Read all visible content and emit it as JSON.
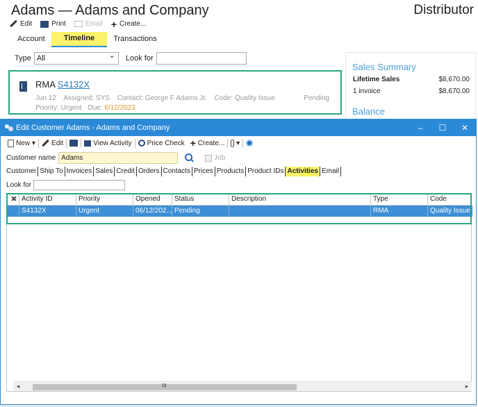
{
  "background": {
    "title": "Adams — Adams and Company",
    "role": "Distributor",
    "toolbar": {
      "edit": "Edit",
      "print": "Print",
      "email": "Email",
      "create": "Create..."
    },
    "tabs": [
      "Account",
      "Timeline",
      "Transactions"
    ],
    "filter": {
      "type_label": "Type",
      "type_value": "All",
      "look_label": "Look for",
      "look_value": ""
    },
    "activity_card": {
      "kind": "RMA",
      "number": "S4132X",
      "date": "Jun 12",
      "assigned": "Assigned: SYS",
      "contact": "Contact: George F Adams Jr.",
      "code": "Code: Quality Issue",
      "status": "Pending",
      "priority": "Priority: Urgent",
      "due_label": "Due:",
      "due_value": "6/12/2023"
    },
    "sales_summary": {
      "title": "Sales Summary",
      "lifetime_label": "Lifetime Sales",
      "lifetime_value": "$8,670.00",
      "invoices_label": "1 invoice",
      "invoices_value": "$8,670.00",
      "balance_title": "Balance"
    }
  },
  "dialog": {
    "title": "Edit Customer Adams - Adams and Company",
    "window_buttons": {
      "minimize": "–",
      "maximize": "☐",
      "close": "✕"
    },
    "toolbar": {
      "new": "New",
      "edit": "Edit",
      "view_activity": "View Activity",
      "price_check": "Price Check",
      "create": "Create..."
    },
    "customer_label": "Customer name",
    "customer_value": "Adams",
    "job_label": "Job",
    "tabs": [
      {
        "label": "Customer",
        "active": false
      },
      {
        "label": "Ship To",
        "active": false
      },
      {
        "label": "Invoices",
        "active": false
      },
      {
        "label": "Sales",
        "active": false
      },
      {
        "label": "Credit",
        "active": false
      },
      {
        "label": "Orders",
        "active": false
      },
      {
        "label": "Contacts",
        "active": false
      },
      {
        "label": "Prices",
        "active": false
      },
      {
        "label": "Products",
        "active": false
      },
      {
        "label": "Product IDs",
        "active": false
      },
      {
        "label": "Activities",
        "active": true
      },
      {
        "label": "Email",
        "active": false
      }
    ],
    "look_label": "Look for",
    "look_value": "",
    "grid": {
      "columns": [
        "Activity ID",
        "Priority",
        "Opened",
        "Status",
        "Description",
        "Type",
        "Code"
      ],
      "rows": [
        [
          "S4132X",
          "Urgent",
          "06/12/202...",
          "Pending",
          "",
          "RMA",
          "Quality Issue"
        ]
      ]
    },
    "scrollbar_grip": "III"
  }
}
